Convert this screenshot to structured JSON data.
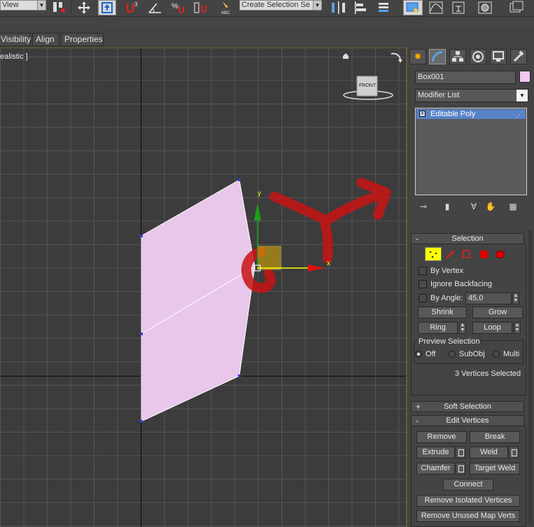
{
  "toolbar": {
    "view_combo": "View",
    "selection_set_combo": "Create Selection Se",
    "icons": [
      "link-icon",
      "move-icon",
      "select-manipulate-icon",
      "angle-snap-icon",
      "snap-icon",
      "percent-snap-icon",
      "spinner-snap-icon",
      "edit-named-selection-icon",
      "mirror-icon",
      "align-icon",
      "layer-manager-icon",
      "graphite-ribbon-icon",
      "curve-editor-icon",
      "schematic-view-icon",
      "material-editor-icon",
      "render-setup-icon"
    ]
  },
  "ribbon": {
    "tabs": [
      "Visibility",
      "Align",
      "Properties"
    ]
  },
  "viewport": {
    "label": "ealistic ]",
    "viewcube_label": "FRONT",
    "gizmo": {
      "y_label": "y",
      "x_label": "x"
    }
  },
  "colors": {
    "object_fill": "#e8c7ea",
    "object_color_swatch": "#f0c8f0",
    "stack_highlight": "#5782c6",
    "vertex_mode_active": "#ffff00",
    "annotation_red": "#c81414",
    "gizmo_y": "#1aa31a",
    "gizmo_x": "#e01010",
    "gizmo_plane": "#e0b000"
  },
  "panel": {
    "tabs": [
      "create-icon",
      "modify-icon",
      "hierarchy-icon",
      "motion-icon",
      "display-icon",
      "utilities-icon"
    ],
    "object_name": "Box001",
    "modifier_list": "Modifier List",
    "stack_items": [
      "Editable Poly"
    ],
    "stack_tools": [
      "pin-stack-icon",
      "show-end-result-icon",
      "make-unique-icon",
      "remove-modifier-icon",
      "configure-modifier-sets-icon"
    ],
    "selection": {
      "title": "Selection",
      "subobject_icons": [
        "vertex-icon",
        "edge-icon",
        "border-icon",
        "polygon-icon",
        "element-icon"
      ],
      "by_vertex": "By Vertex",
      "ignore_backfacing": "Ignore Backfacing",
      "by_angle": "By Angle:",
      "angle_value": "45,0",
      "shrink": "Shrink",
      "grow": "Grow",
      "ring": "Ring",
      "loop": "Loop",
      "preview_title": "Preview Selection",
      "preview_off": "Off",
      "preview_subobj": "SubObj",
      "preview_multi": "Multi",
      "status": "3 Vertices Selected"
    },
    "soft_selection": {
      "sign": "+",
      "title": "Soft Selection"
    },
    "edit_vertices": {
      "sign": "-",
      "title": "Edit Vertices",
      "remove": "Remove",
      "break": "Break",
      "extrude": "Extrude",
      "weld": "Weld",
      "chamfer": "Chamfer",
      "target_weld": "Target Weld",
      "connect": "Connect",
      "remove_isolated": "Remove Isolated Vertices",
      "remove_unused_map": "Remove Unused Map Verts"
    },
    "selection_sign": "-"
  }
}
